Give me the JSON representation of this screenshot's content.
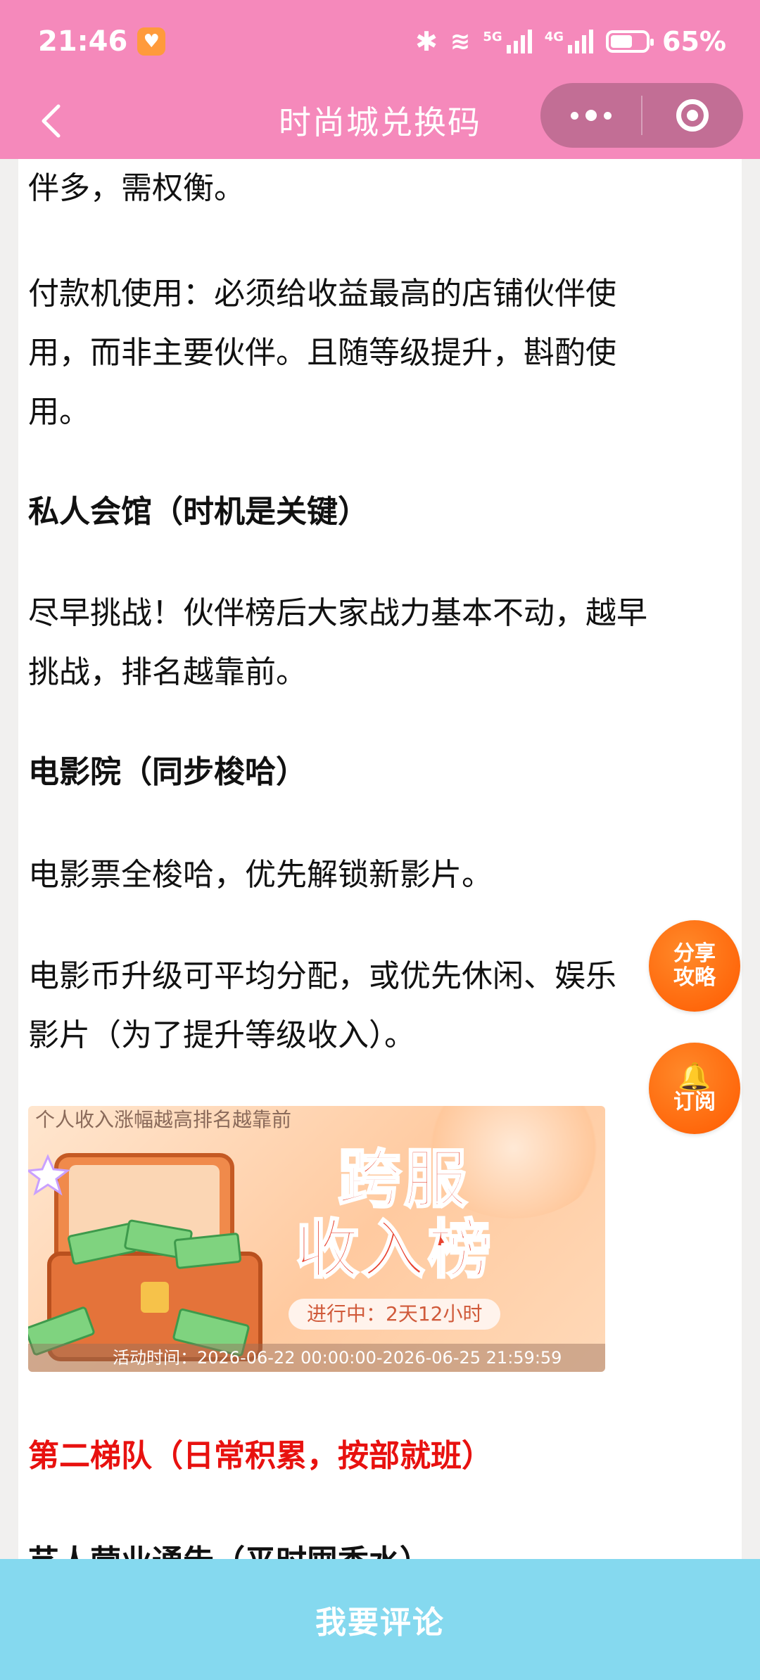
{
  "status_bar": {
    "time": "21:46",
    "battery_percent": "65%",
    "network_5g": "5G",
    "network_4g": "4G",
    "wifi_label": "6"
  },
  "header": {
    "title": "时尚城兑换码",
    "back_icon": "chevron-left-icon",
    "more_icon": "more-dots-icon",
    "target_icon": "target-icon"
  },
  "article": {
    "p1": "伴多，需权衡。",
    "p2_line1": "付款机使用：必须给收益最高的店铺伙伴使",
    "p2_line2": "用，而非主要伙伴。且随等级提升，斟酌使",
    "p2_line3": "用。",
    "h1": "私人会馆（时机是关键）",
    "p3_line1": "尽早挑战！伙伴榜后大家战力基本不动，越早",
    "p3_line2": "挑战，排名越靠前。",
    "h2": "电影院（同步梭哈）",
    "p4": "电影票全梭哈，优先解锁新影片。",
    "p5_line1": "电影币升级可平均分配，或优先休闲、娱乐",
    "p5_line2": "影片（为了提升等级收入）。",
    "h3": "第二梯队（日常积累，按部就班）",
    "h4": "艺人营业通告（平时囤香水）"
  },
  "banner": {
    "top_text": "个人收入涨幅越高排名越靠前",
    "title_line1": "跨服",
    "title_line2": "收入榜",
    "status": "进行中：2天12小时",
    "time": "活动时间：2026-06-22 00:00:00-2026-06-25 21:59:59",
    "colors": {
      "title": "#e8432f",
      "accent": "#ff9a4d"
    }
  },
  "floating": {
    "share_line1": "分享",
    "share_line2": "攻略",
    "subscribe": "订阅",
    "bell_icon": "bell-icon"
  },
  "bottom_bar": {
    "comment": "我要评论"
  },
  "colors": {
    "header_bg": "#f589bb",
    "bottom_bg": "#85d9ef",
    "fab_bg": "#ff5a00",
    "heading_red": "#e8110f"
  }
}
